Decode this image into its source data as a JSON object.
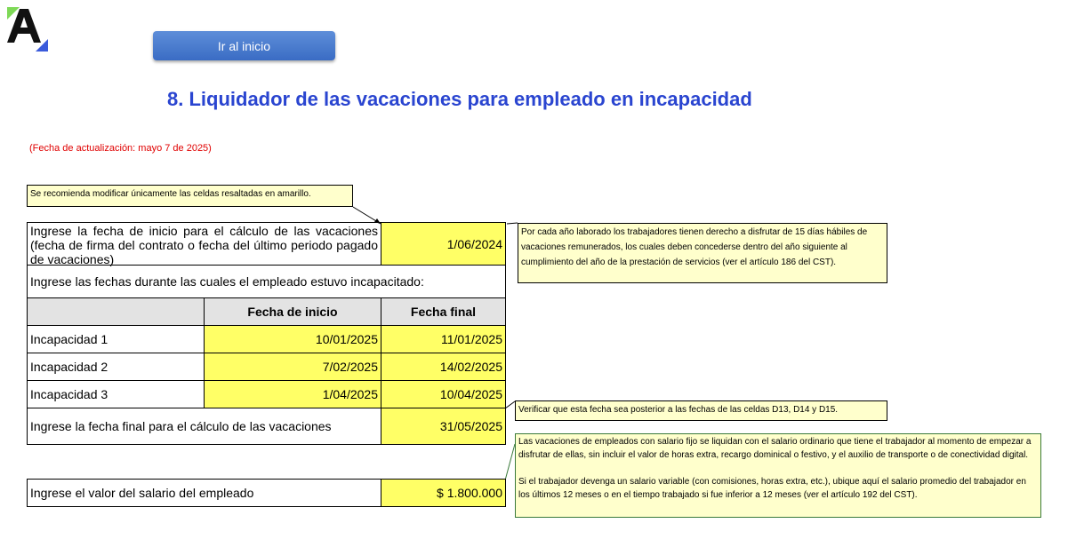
{
  "button": {
    "label": "Ir al inicio"
  },
  "title": "8. Liquidador de las vacaciones para empleado en incapacidad",
  "update_note": "(Fecha de actualización: mayo 7 de 2025)",
  "notes": {
    "yellow_hint": "Se recomienda modificar únicamente las celdas resaltadas en amarillo.",
    "vacation_rule": "Por cada año laborado los trabajadores tienen derecho a disfrutar de 15 días hábiles de vacaciones remunerados, los cuales deben concederse dentro del año siguiente al cumplimiento del año de la prestación de servicios (ver el artículo 186 del CST).",
    "verify_date": "Verificar que esta fecha sea posterior a las fechas de las celdas D13, D14 y D15.",
    "salary_p1": "Las vacaciones de empleados con salario fijo se liquidan con el salario ordinario que tiene el trabajador al momento de empezar a disfrutar de ellas, sin incluir el valor de horas extra, recargo dominical o festivo, y el auxilio de transporte o de conectividad digital.",
    "salary_p2": "Si el trabajador devenga un salario variable (con comisiones, horas extra, etc.), ubique aquí el salario promedio del trabajador en los últimos 12 meses o en el tiempo trabajado si fue inferior a 12 meses (ver el artículo 192 del CST)."
  },
  "form": {
    "start_label": "Ingrese la fecha de inicio para el cálculo de las vacaciones (fecha de firma del contrato o fecha del último periodo pagado de vacaciones)",
    "start_value": "1/06/2024",
    "incap_label": "Ingrese las fechas durante las cuales el empleado estuvo incapacitado:",
    "col_start": "Fecha de inicio",
    "col_end": "Fecha final",
    "rows": [
      {
        "label": "Incapacidad 1",
        "start": "10/01/2025",
        "end": "11/01/2025"
      },
      {
        "label": "Incapacidad 2",
        "start": "7/02/2025",
        "end": "14/02/2025"
      },
      {
        "label": "Incapacidad 3",
        "start": "1/04/2025",
        "end": "10/04/2025"
      }
    ],
    "end_label": "Ingrese la fecha final para el cálculo de las vacaciones",
    "end_value": "31/05/2025",
    "salary_label": "Ingrese el valor del salario del empleado",
    "salary_value": "$ 1.800.000"
  },
  "colors": {
    "title": "#2a45d0",
    "update": "#e00000",
    "input_cell": "#ffff66",
    "note_bg": "#ffffcc"
  }
}
